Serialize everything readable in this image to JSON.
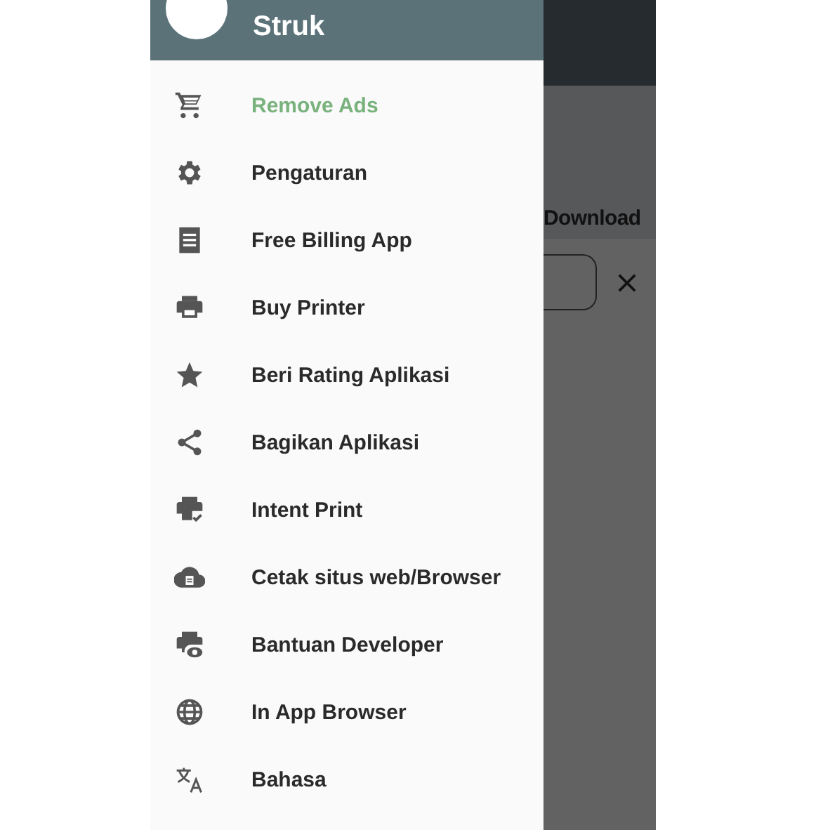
{
  "drawer": {
    "title": "Struk",
    "items": [
      {
        "label": "Remove Ads",
        "highlighted": true
      },
      {
        "label": "Pengaturan",
        "highlighted": false
      },
      {
        "label": "Free Billing App",
        "highlighted": false
      },
      {
        "label": "Buy Printer",
        "highlighted": false
      },
      {
        "label": "Beri Rating Aplikasi",
        "highlighted": false
      },
      {
        "label": "Bagikan Aplikasi",
        "highlighted": false
      },
      {
        "label": "Intent Print",
        "highlighted": false
      },
      {
        "label": "Cetak situs web/Browser",
        "highlighted": false
      },
      {
        "label": "Bantuan Developer",
        "highlighted": false
      },
      {
        "label": "In App Browser",
        "highlighted": false
      },
      {
        "label": "Bahasa",
        "highlighted": false
      }
    ]
  },
  "background": {
    "tab_label": "Download"
  }
}
